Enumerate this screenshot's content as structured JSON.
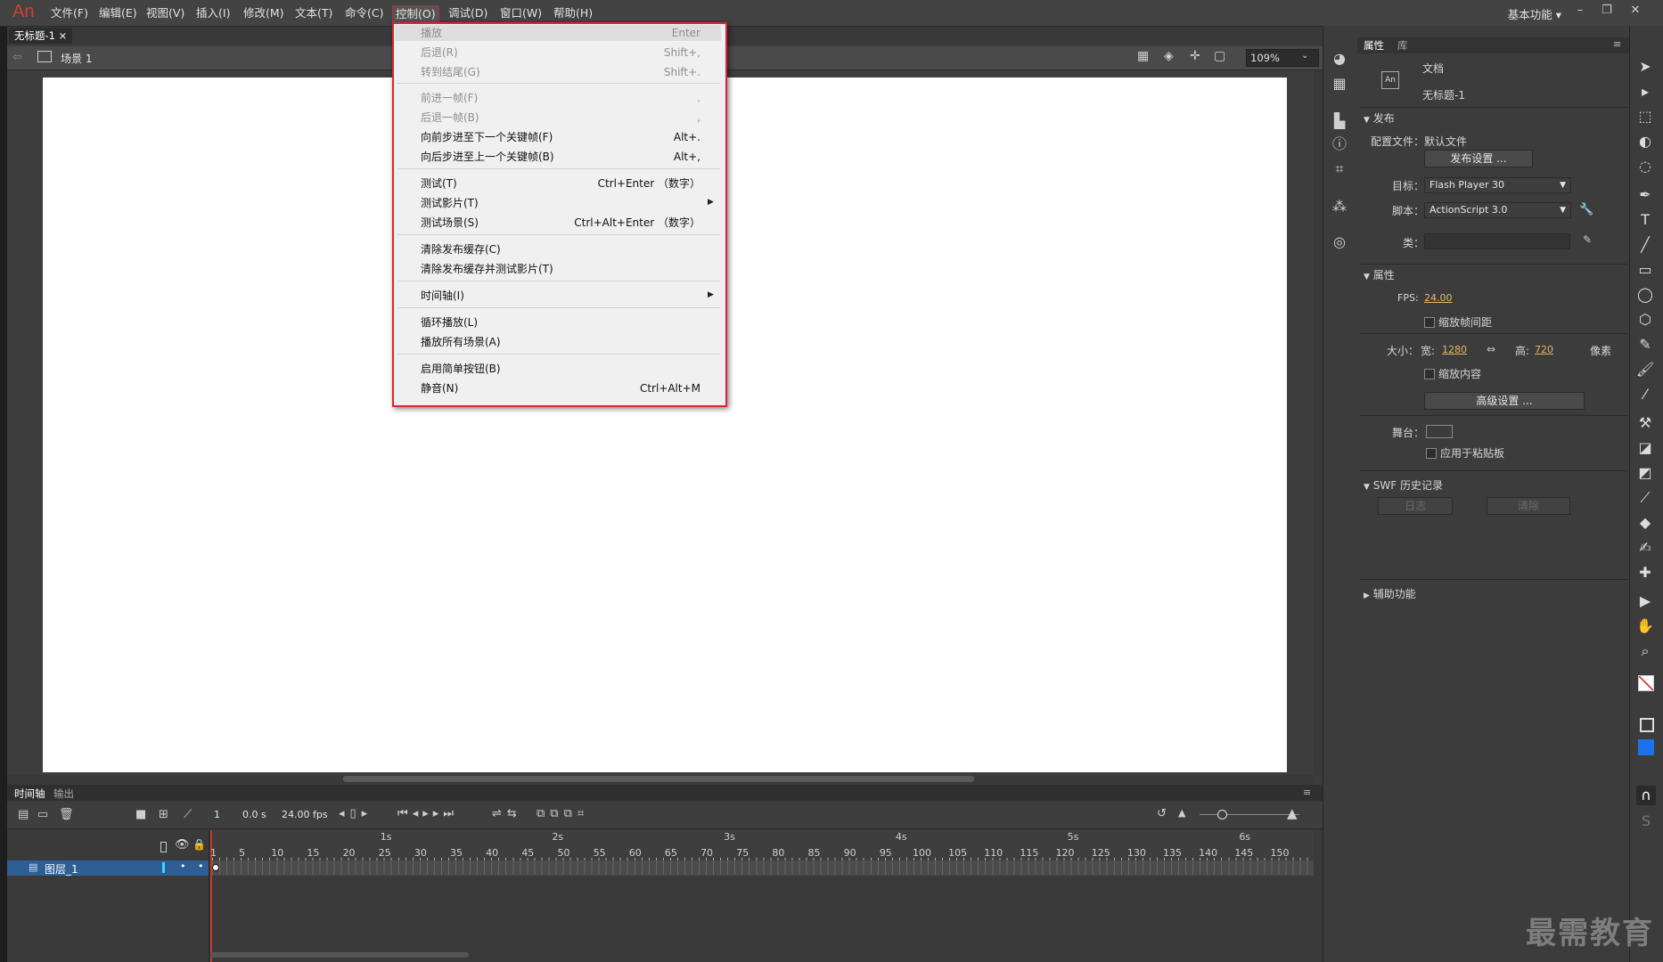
{
  "app": {
    "logo": "An",
    "workspace": "基本功能 ▾"
  },
  "menubar": [
    "文件(F)",
    "编辑(E)",
    "视图(V)",
    "插入(I)",
    "修改(M)",
    "文本(T)",
    "命令(C)",
    "控制(O)",
    "调试(D)",
    "窗口(W)",
    "帮助(H)"
  ],
  "doc": {
    "tab": "无标题-1 ×",
    "scene": "场景 1",
    "zoom": "109%"
  },
  "control_menu": {
    "items": [
      {
        "label": "播放",
        "shortcut": "Enter",
        "disabled": true
      },
      {
        "label": "后退(R)",
        "shortcut": "Shift+,",
        "disabled": true
      },
      {
        "label": "转到结尾(G)",
        "shortcut": "Shift+.",
        "disabled": true
      },
      {
        "label": "前进一帧(F)",
        "shortcut": ".",
        "disabled": true
      },
      {
        "label": "后退一帧(B)",
        "shortcut": ",",
        "disabled": true
      },
      {
        "label": "向前步进至下一个关键帧(F)",
        "shortcut": "Alt+.",
        "disabled": false
      },
      {
        "label": "向后步进至上一个关键帧(B)",
        "shortcut": "Alt+,",
        "disabled": false
      },
      {
        "label": "测试(T)",
        "shortcut": "Ctrl+Enter （数字）",
        "disabled": false
      },
      {
        "label": "测试影片(T)",
        "shortcut": "",
        "disabled": false
      },
      {
        "label": "测试场景(S)",
        "shortcut": "Ctrl+Alt+Enter （数字）",
        "disabled": false
      },
      {
        "label": "清除发布缓存(C)",
        "shortcut": "",
        "disabled": false
      },
      {
        "label": "清除发布缓存并测试影片(T)",
        "shortcut": "",
        "disabled": false
      },
      {
        "label": "时间轴(I)",
        "shortcut": "",
        "disabled": false
      },
      {
        "label": "循环播放(L)",
        "shortcut": "",
        "disabled": false
      },
      {
        "label": "播放所有场景(A)",
        "shortcut": "",
        "disabled": false
      },
      {
        "label": "启用简单按钮(B)",
        "shortcut": "",
        "disabled": false
      },
      {
        "label": "静音(N)",
        "shortcut": "Ctrl+Alt+M",
        "disabled": false
      }
    ]
  },
  "timeline": {
    "tabs": [
      "时间轴",
      "输出"
    ],
    "current_frame": "1",
    "time": "0.0 s",
    "fps": "24.00 fps",
    "layer_name": "图层_1",
    "frame_numbers": [
      "1",
      "5",
      "10",
      "15",
      "20",
      "25",
      "30",
      "35",
      "40",
      "45",
      "50",
      "55",
      "60",
      "65",
      "70",
      "75",
      "80",
      "85",
      "90",
      "95",
      "100",
      "105",
      "110",
      "115",
      "120",
      "125",
      "130",
      "135",
      "140",
      "145",
      "150"
    ],
    "seconds": [
      "1s",
      "2s",
      "3s",
      "4s",
      "5s",
      "6s"
    ]
  },
  "properties": {
    "tabs": [
      "属性",
      "库"
    ],
    "doc_type": "文档",
    "doc_name": "无标题-1",
    "publish_section": "发布",
    "profile_label": "配置文件：",
    "profile_value": "默认文件",
    "publish_settings_btn": "发布设置 ...",
    "target_label": "目标：",
    "target_value": "Flash Player 30",
    "script_label": "脚本：",
    "script_value": "ActionScript 3.0",
    "class_label": "类：",
    "props_section": "属性",
    "fps_label": "FPS:",
    "fps_value": "24.00",
    "scale_spans_label": "缩放帧间距",
    "size_label": "大小：",
    "width_label": "宽:",
    "width_value": "1280",
    "height_label": "高:",
    "height_value": "720",
    "unit": "像素",
    "scale_content_label": "缩放内容",
    "advanced_btn": "高级设置 ...",
    "stage_label": "舞台：",
    "stage_color": "#ffffff",
    "pasteboard_label": "应用于粘贴板",
    "swf_history": "SWF 历史记录",
    "log_btn": "日志",
    "clear_btn": "清除",
    "accessibility": "辅助功能"
  },
  "watermark": "最需教育",
  "colors": {
    "accent_red": "#e0262b",
    "layer_select": "#2d5f96",
    "stage": "#ffffff"
  }
}
